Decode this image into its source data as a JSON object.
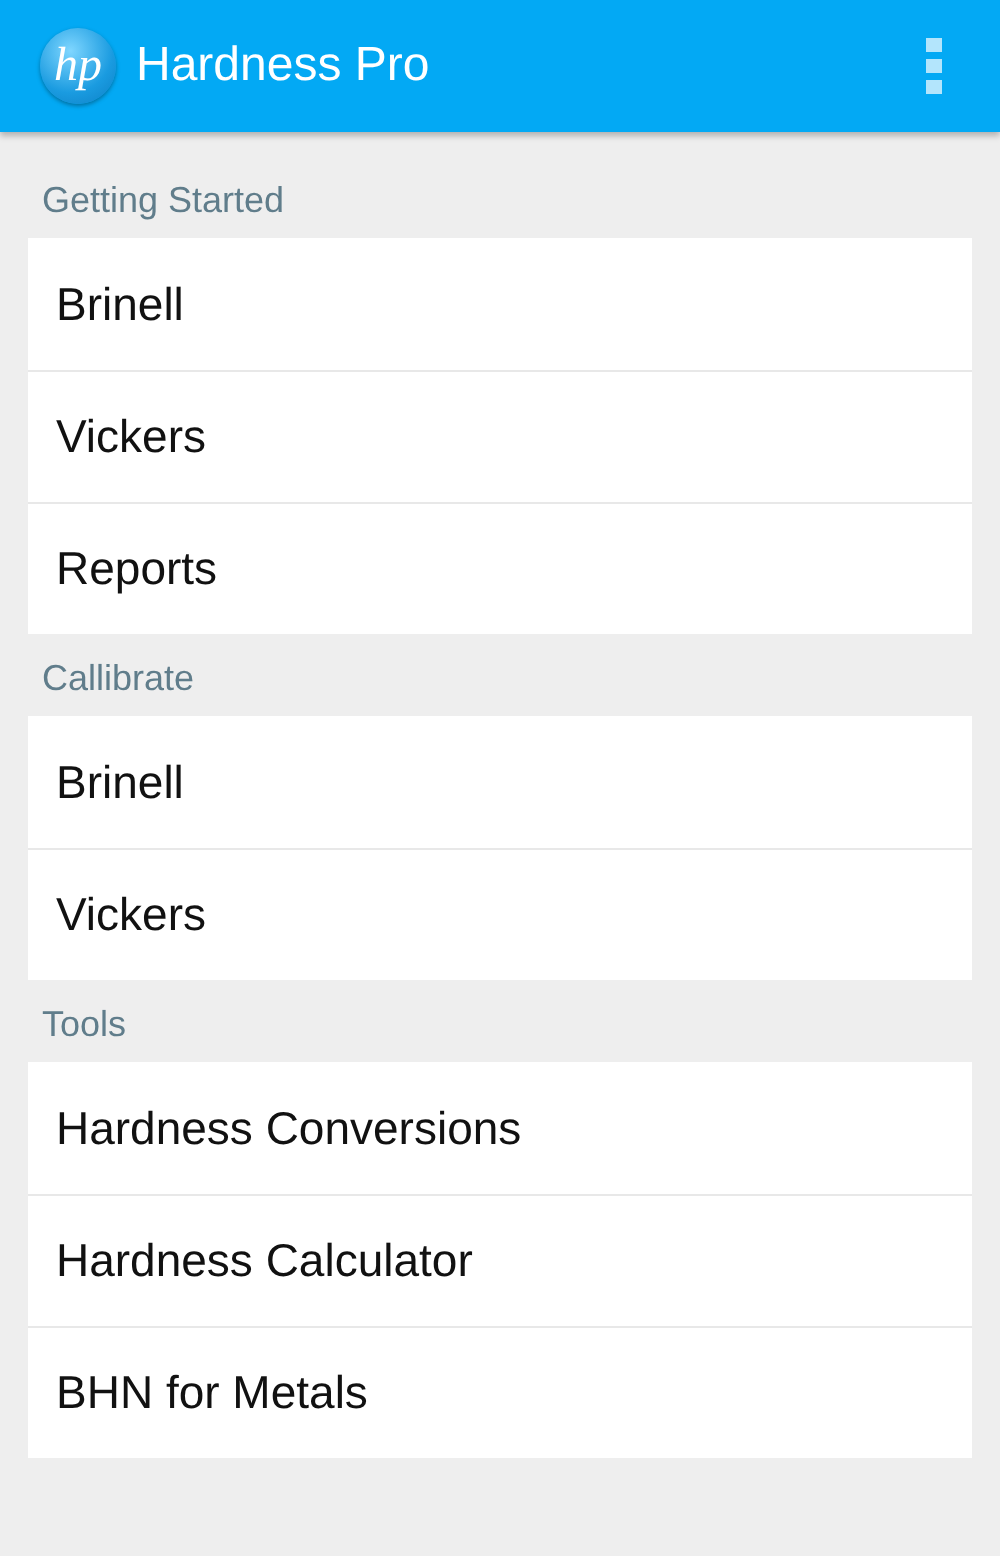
{
  "app_bar": {
    "logo_text": "hp",
    "title": "Hardness Pro"
  },
  "sections": [
    {
      "title": "Getting Started",
      "items": [
        "Brinell",
        "Vickers",
        "Reports"
      ]
    },
    {
      "title": "Callibrate",
      "items": [
        "Brinell",
        "Vickers"
      ]
    },
    {
      "title": "Tools",
      "items": [
        "Hardness Conversions",
        "Hardness Calculator",
        "BHN for Metals"
      ]
    }
  ]
}
